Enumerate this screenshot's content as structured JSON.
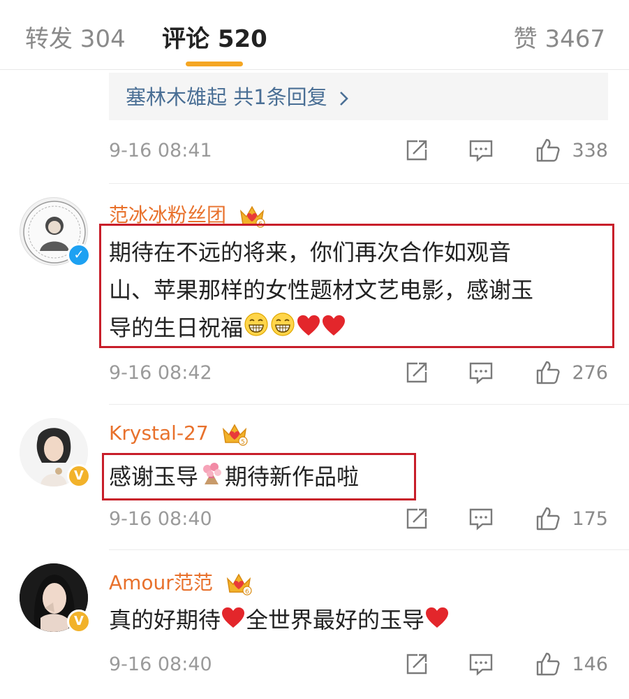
{
  "tabs": {
    "repost": "转发 304",
    "comment": "评论 520",
    "like": "赞 3467"
  },
  "prev_comment": {
    "reply_link": "塞林木雄起  共1条回复",
    "time": "9-16 08:41",
    "likes": "338"
  },
  "comments": [
    {
      "user": "范冰冰粉丝团",
      "verify": "blue",
      "text_lines": [
        "期待在不远的将来，你们再次合作如观音",
        "山、苹果那样的女性题材文艺电影，感谢玉",
        "导的生日祝福"
      ],
      "emojis": [
        "grin",
        "grin",
        "heart",
        "heart"
      ],
      "time": "9-16 08:42",
      "likes": "276"
    },
    {
      "user": "Krystal-27",
      "verify": "gold",
      "text_a": "感谢玉导",
      "text_b": "期待新作品啦",
      "emojis": [
        "bouquet"
      ],
      "time": "9-16 08:40",
      "likes": "175"
    },
    {
      "user": "Amour范范",
      "verify": "gold",
      "text_a": "真的好期待",
      "text_b": "全世界最好的玉导",
      "emojis": [
        "heart",
        "heart"
      ],
      "time": "9-16 08:40",
      "likes": "146"
    }
  ],
  "colors": {
    "accent": "#f5a623",
    "username": "#e8712c",
    "link": "#4a6f95",
    "highlight_box": "#c81e2a"
  }
}
